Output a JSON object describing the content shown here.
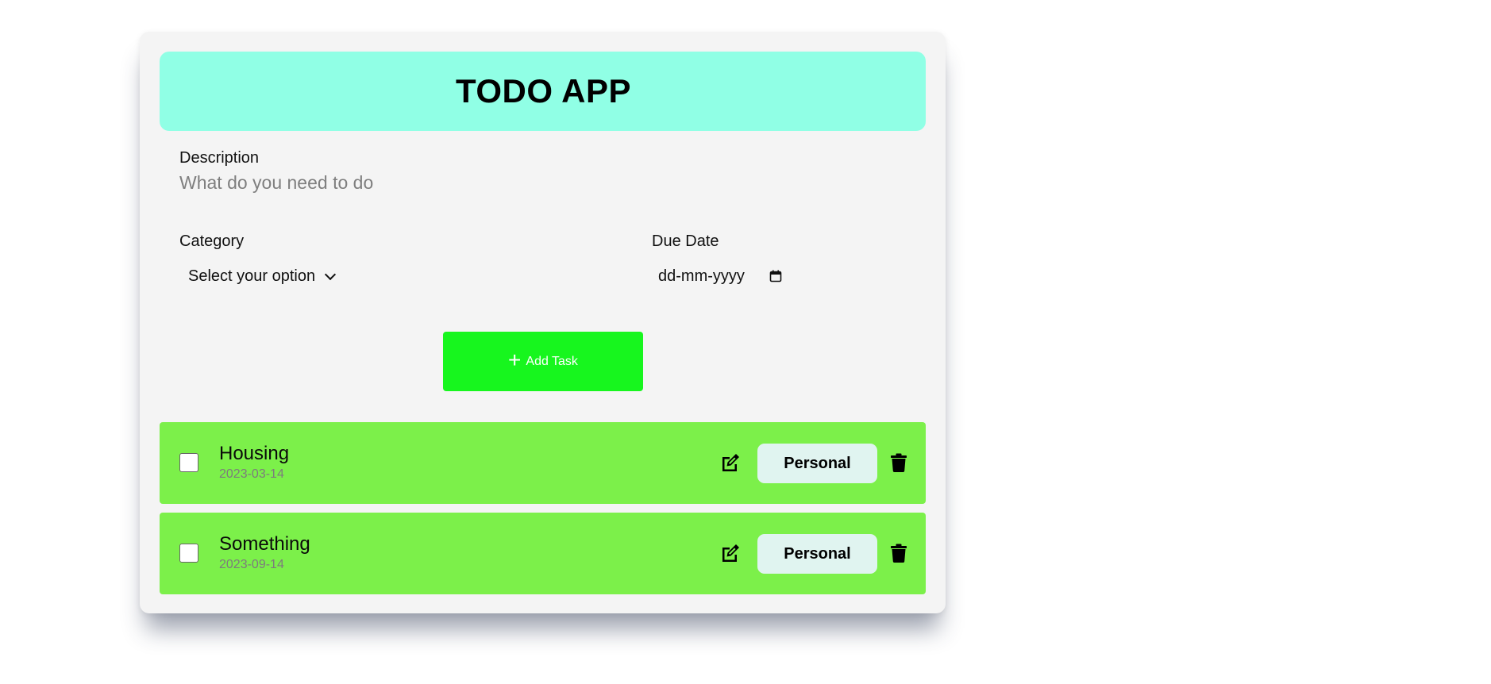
{
  "app": {
    "title": "TODO APP"
  },
  "form": {
    "description_label": "Description",
    "description_placeholder": "What do you need to do",
    "description_value": "",
    "category_label": "Category",
    "category_selected": "Select your option",
    "due_date_label": "Due Date",
    "due_date_placeholder": "dd-mm-yyyy",
    "add_button_label": "Add Task"
  },
  "tasks": [
    {
      "title": "Housing",
      "date": "2023-03-14",
      "category": "Personal",
      "done": false
    },
    {
      "title": "Something",
      "date": "2023-09-14",
      "category": "Personal",
      "done": false
    }
  ],
  "colors": {
    "header_bg": "#90ffe5",
    "add_button_bg": "#17f61e",
    "task_bg": "#7cf04a",
    "badge_bg": "#e0f4f0",
    "card_bg": "#f4f4f4"
  },
  "icons": {
    "add": "plus-icon",
    "edit": "edit-icon",
    "delete": "trash-icon",
    "calendar": "calendar-icon",
    "dropdown": "chevron-down-icon"
  }
}
